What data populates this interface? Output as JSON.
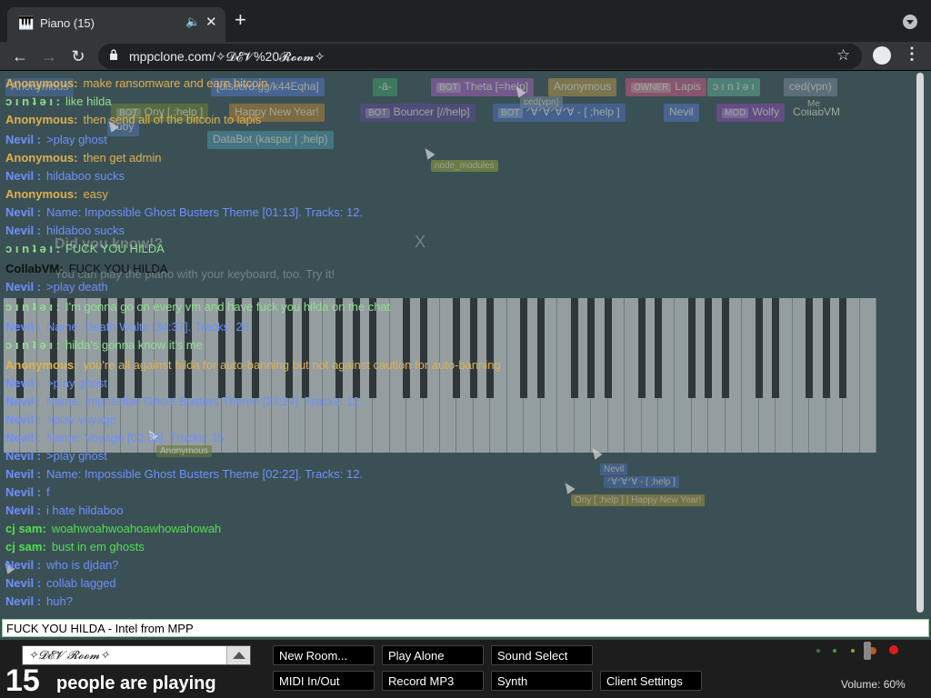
{
  "browser": {
    "tab_title": "Piano (15)",
    "url": "mppclone.com/✧𝓓𝓔𝓥%20𝓡𝓸𝓸𝓶✧",
    "new_tab_symbol": "+",
    "tab_close_symbol": "✕"
  },
  "participants": [
    {
      "tag": "",
      "name": "Anonymous",
      "color": "#4a6a9a"
    },
    {
      "tag": "",
      "name": "[discord.gg/k44Eqha]",
      "color": "#4f6fb2"
    },
    {
      "tag": "",
      "name": "-ā-",
      "color": "#3f8f66"
    },
    {
      "tag": "BOT",
      "name": "Theta [=help]",
      "color": "#8f5fa8"
    },
    {
      "tag": "",
      "name": "Anonymous",
      "color": "#a08a4a"
    },
    {
      "tag": "OWNER",
      "name": "Lapis",
      "color": "#b05a7a"
    },
    {
      "tag": "",
      "name": "ɔ ı n ʇ ǝ ı",
      "color": "#5a9a8a"
    },
    {
      "tag": "",
      "name": "ced(vpn)",
      "color": "#6f7f8f"
    },
    {
      "tag": "",
      "name": "ruby",
      "color": "#4f6fa0"
    },
    {
      "tag": "BOT",
      "name": "Ony [ ;help ]",
      "color": "#6a7a3a"
    },
    {
      "tag": "",
      "name": "Happy New Year!",
      "color": "#a07a3a"
    },
    {
      "tag": "BOT",
      "name": "Bouncer [//help]",
      "color": "#5a4a8a"
    },
    {
      "tag": "BOT",
      "name": "ᐟ∀ᐟ∀ᐟ∀ᐟ∀ - [ ;help ]",
      "color": "#4a6aaa"
    },
    {
      "tag": "",
      "name": "Nevil",
      "color": "#4f6fb2"
    },
    {
      "tag": "MOD",
      "name": "Wolfy",
      "color": "#7a4aa0"
    },
    {
      "tag": "",
      "name": "CollabVM",
      "color": "#3b5054"
    },
    {
      "tag": "",
      "name": "DataBot (kaspar | ;help)",
      "color": "#4a8a9a"
    }
  ],
  "cursor_tags": [
    {
      "label": "ced(vpn)"
    },
    {
      "label": "Me"
    },
    {
      "label": "node_modules"
    },
    {
      "label": "Anonymous"
    },
    {
      "label": "Nevil"
    },
    {
      "label": "ᐟ∀ᐟ∀ᐟ∀ - [ ;help ]"
    },
    {
      "label": "Ony [ ;help ] | Happy New Year!"
    }
  ],
  "dialog": {
    "heading": "Did you know!?",
    "body": "You can play the piano with your keyboard, too. Try it!",
    "close": "X"
  },
  "chat": [
    {
      "who": "Anonymous:",
      "text": "make ransomware and earn bitcoin",
      "color": "#e0b050"
    },
    {
      "who": "ɔ ı n ʇ ǝ ı :",
      "text": "like hilda",
      "color": "#8fe08f"
    },
    {
      "who": "Anonymous:",
      "text": "then send all of the bitcoin to lapis",
      "color": "#e0b050"
    },
    {
      "who": "Nevil :",
      "text": ">play ghost",
      "color": "#6f8fff"
    },
    {
      "who": "Anonymous:",
      "text": "then get admin",
      "color": "#e0b050"
    },
    {
      "who": "Nevil :",
      "text": "hildaboo sucks",
      "color": "#6f8fff"
    },
    {
      "who": "Anonymous:",
      "text": "easy",
      "color": "#e0b050"
    },
    {
      "who": "Nevil :",
      "text": "Name: Impossible Ghost Busters Theme [01:13]. Tracks: 12.",
      "color": "#6f8fff"
    },
    {
      "who": "Nevil :",
      "text": "hildaboo sucks",
      "color": "#6f8fff"
    },
    {
      "who": "ɔ ı n ʇ ǝ ı :",
      "text": "FUCK YOU HILDA",
      "color": "#8fe08f"
    },
    {
      "who": "CollabVM:",
      "text": "FUCK YOU HILDA",
      "color": "#111111"
    },
    {
      "who": "Nevil :",
      "text": ">play death",
      "color": "#6f8fff"
    },
    {
      "who": "ɔ ı n ʇ ǝ ı :",
      "text": "I'm gonna go on every vm and have fuck you hilda on the chat",
      "color": "#8fe08f"
    },
    {
      "who": "Nevil :",
      "text": "Name: Death Waltz [34:37]. Tracks: 26.",
      "color": "#6f8fff"
    },
    {
      "who": "ɔ ı n ʇ ǝ ı :",
      "text": "hilda's gonna know it's me",
      "color": "#8fe08f"
    },
    {
      "who": "Anonymous:",
      "text": "you're all against hilda for auto-banning but not against caution for auto-banning",
      "color": "#e0b050"
    },
    {
      "who": "Nevil :",
      "text": ">play ghost",
      "color": "#6f8fff"
    },
    {
      "who": "Nevil :",
      "text": "Name: Impossible Ghost Busters Theme [23:24]. Tracks: 12.",
      "color": "#6f8fff"
    },
    {
      "who": "Nevil :",
      "text": ">play voyage",
      "color": "#6f8fff"
    },
    {
      "who": "Nevil :",
      "text": "Name: Voyage [02:33]. Tracks: 15.",
      "color": "#6f8fff"
    },
    {
      "who": "Nevil :",
      "text": ">play ghost",
      "color": "#6f8fff"
    },
    {
      "who": "Nevil :",
      "text": "Name: Impossible Ghost Busters Theme [02:22]. Tracks: 12.",
      "color": "#6f8fff"
    },
    {
      "who": "Nevil :",
      "text": "f",
      "color": "#6f8fff"
    },
    {
      "who": "Nevil :",
      "text": "i hate hildaboo",
      "color": "#6f8fff"
    },
    {
      "who": "cj sam:",
      "text": "woahwoahwoahoawhowahowah",
      "color": "#4fe04f"
    },
    {
      "who": "cj sam:",
      "text": "bust in em ghosts",
      "color": "#4fe04f"
    },
    {
      "who": "Nevil :",
      "text": "who is djdan?",
      "color": "#6f8fff"
    },
    {
      "who": "Nevil :",
      "text": "collab lagged",
      "color": "#6f8fff"
    },
    {
      "who": "Nevil :",
      "text": "huh?",
      "color": "#6f8fff"
    }
  ],
  "chat_input": {
    "value": "FUCK YOU HILDA - Intel from MPP"
  },
  "room": {
    "name": "✧𝓓𝓔𝓥 𝓡𝓸𝓸𝓶✧"
  },
  "people": {
    "count": "15",
    "label": "people are playing"
  },
  "buttons": {
    "new_room": "New Room...",
    "play_alone": "Play Alone",
    "sound_select": "Sound Select",
    "midi": "MIDI In/Out",
    "record": "Record MP3",
    "synth": "Synth",
    "client_settings": "Client Settings"
  },
  "volume": {
    "label": "Volume: 60%",
    "level": 0.6
  }
}
